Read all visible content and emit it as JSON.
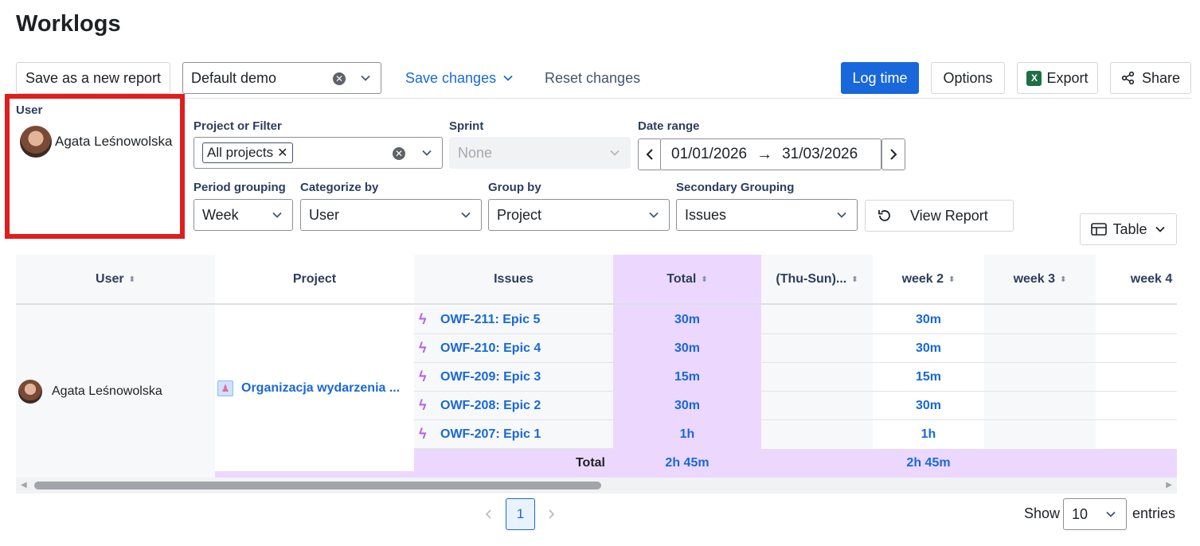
{
  "page": {
    "title": "Worklogs"
  },
  "toolbar": {
    "save_new": "Save as a new report",
    "report_select": "Default demo",
    "save_changes": "Save changes",
    "reset_changes": "Reset changes",
    "log_time": "Log time",
    "options": "Options",
    "export": "Export",
    "share": "Share"
  },
  "user_filter": {
    "label": "User",
    "name": "Agata Leśnowolska"
  },
  "filters": {
    "project_label": "Project or Filter",
    "project_chip": "All projects",
    "sprint_label": "Sprint",
    "sprint_value": "None",
    "date_label": "Date range",
    "date_from": "01/01/2026",
    "date_to": "31/03/2026",
    "period_label": "Period grouping",
    "period_value": "Week",
    "categorize_label": "Categorize by",
    "categorize_value": "User",
    "group_label": "Group by",
    "group_value": "Project",
    "secondary_label": "Secondary Grouping",
    "secondary_value": "Issues",
    "view_report": "View Report",
    "view_mode": "Table"
  },
  "table": {
    "headers": {
      "user": "User",
      "project": "Project",
      "issues": "Issues",
      "total": "Total",
      "week1": "(Thu-Sun)...",
      "week2": "week 2",
      "week3": "week 3",
      "week4": "week 4"
    },
    "user_name": "Agata Leśnowolska",
    "project_name": "Organizacja wydarzenia ...",
    "rows": [
      {
        "issue": "OWF-211: Epic 5",
        "total": "30m",
        "week2": "30m"
      },
      {
        "issue": "OWF-210: Epic 4",
        "total": "30m",
        "week2": "30m"
      },
      {
        "issue": "OWF-209: Epic 3",
        "total": "15m",
        "week2": "15m"
      },
      {
        "issue": "OWF-208: Epic 2",
        "total": "30m",
        "week2": "30m"
      },
      {
        "issue": "OWF-207: Epic 1",
        "total": "1h",
        "week2": "1h"
      }
    ],
    "footer": {
      "label": "Total",
      "total": "2h 45m",
      "week2": "2h 45m"
    }
  },
  "pagination": {
    "current_page": "1",
    "show_label": "Show",
    "page_size": "10",
    "entries_label": "entries"
  },
  "colors": {
    "primary": "#1868db",
    "total_column": "#ecd8ff",
    "highlight_box": "#e01e1e",
    "epic_icon": "#b464e8"
  }
}
